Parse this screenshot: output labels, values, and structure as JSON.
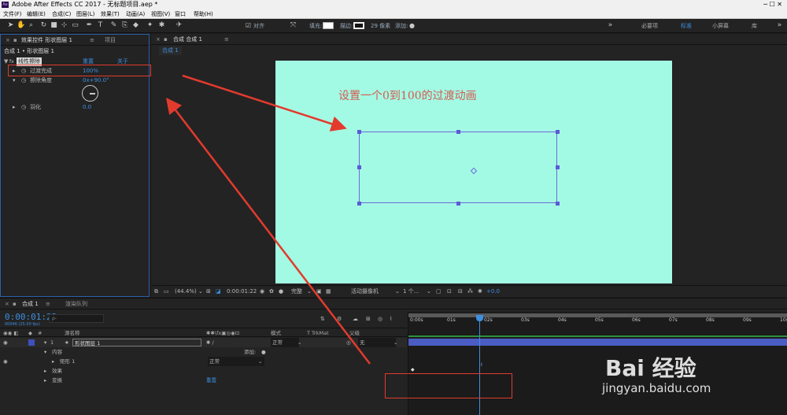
{
  "app": {
    "logo": "Ae",
    "title": "Adobe After Effects CC 2017 - 无标题项目.aep *"
  },
  "menu": [
    "文件(F)",
    "编辑(E)",
    "合成(C)",
    "图层(L)",
    "效果(T)",
    "动画(A)",
    "视图(V)",
    "窗口",
    "帮助(H)"
  ],
  "toolbar": {
    "align_label": "对齐",
    "fill_label": "填充:",
    "stroke_label": "描边:",
    "stroke_width": "29 像素",
    "add_label": "添加:",
    "workspaces": [
      "必要项",
      "标准",
      "小屏幕",
      "库"
    ]
  },
  "effect_controls": {
    "tab_label": "效果控件 形状图层 1",
    "project_tab": "项目",
    "breadcrumb": "合成 1 • 形状图层 1",
    "effect_name": "线性擦除",
    "reset_label": "重置",
    "about_label": "关于",
    "props": [
      {
        "name": "过渡完成",
        "value": "100%"
      },
      {
        "name": "擦除角度",
        "value": "0x+90.0°"
      },
      {
        "name": "羽化",
        "value": "0.0"
      }
    ]
  },
  "composition": {
    "tab_label": "合成 合成 1",
    "sub_tab": "合成 1",
    "annotation": "设置一个0到100的过渡动画",
    "zoom": "(44.4%)",
    "timecode": "0:00:01:22",
    "quality": "完整",
    "camera": "活动摄像机",
    "views": "1 个...",
    "exposure": "+0.0"
  },
  "timeline": {
    "tab_label": "合成 1",
    "render_tab": "渲染队列",
    "timecode": "0:00:01:22",
    "fps_info": "00046 (25.00 fps)",
    "search_placeholder": "ρ-",
    "headers": {
      "source_name": "源名称",
      "mode": "模式",
      "trkmat": "T  TrkMat",
      "parent": "父级"
    },
    "layers": [
      {
        "index": "1",
        "name": "形状图层 1",
        "mode": "正常",
        "parent": "无"
      },
      {
        "index": "",
        "name": "内容",
        "mode": "",
        "parent": "添加:"
      },
      {
        "index": "",
        "name": "矩形 1",
        "mode": "正常",
        "parent": ""
      },
      {
        "index": "",
        "name": "效果",
        "mode": "",
        "parent": ""
      },
      {
        "index": "",
        "name": "变换",
        "mode": "重置",
        "parent": ""
      }
    ],
    "ruler": [
      "0:00s",
      "01s",
      "02s",
      "03s",
      "04s",
      "05s",
      "06s",
      "07s",
      "08s",
      "09s",
      "10s"
    ],
    "playhead_seconds": 1.88
  },
  "watermark": {
    "brand": "Bai  经验",
    "url": "jingyan.baidu.com"
  },
  "colors": {
    "canvas": "#a3fae4",
    "highlight": "#e23b2e",
    "accent": "#3d8fe0",
    "layer_bar": "#4b5cc4"
  }
}
